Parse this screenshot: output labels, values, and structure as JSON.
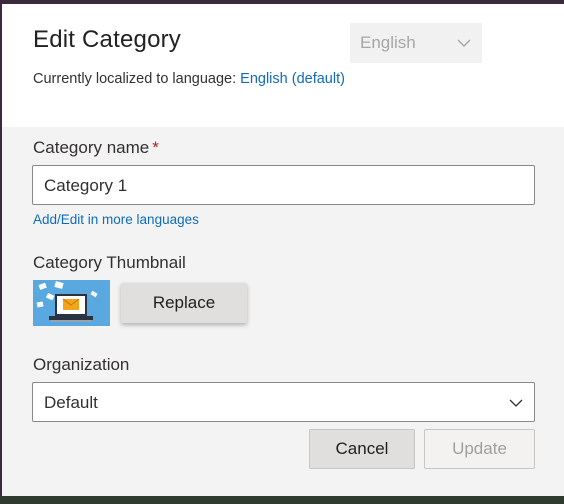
{
  "dialog": {
    "title": "Edit Category",
    "language_select": {
      "value": "English",
      "icon": "chevron-down-icon"
    },
    "localized_prefix": "Currently localized to language:",
    "localized_link": "English (default)"
  },
  "form": {
    "category_name": {
      "label": "Category name",
      "required_mark": "*",
      "value": "Category 1",
      "more_languages_link": "Add/Edit in more languages"
    },
    "thumbnail": {
      "label": "Category Thumbnail",
      "replace_label": "Replace"
    },
    "organization": {
      "label": "Organization",
      "value": "Default",
      "icon": "chevron-down-icon"
    }
  },
  "footer": {
    "cancel_label": "Cancel",
    "update_label": "Update"
  },
  "colors": {
    "accent_link": "#0f6cbd",
    "required": "#a4262c",
    "dialog_body": "#f3f3f3"
  }
}
